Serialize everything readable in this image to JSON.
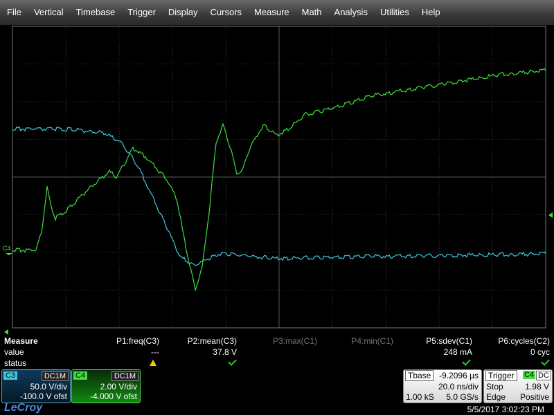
{
  "menu": [
    "File",
    "Vertical",
    "Timebase",
    "Trigger",
    "Display",
    "Cursors",
    "Measure",
    "Math",
    "Analysis",
    "Utilities",
    "Help"
  ],
  "colors": {
    "c3": "#40c8e0",
    "c4": "#40e040",
    "grid": "#5a5a5a"
  },
  "markers": {
    "c4_label": "C4"
  },
  "measure": {
    "title": "Measure",
    "row_labels": [
      "value",
      "status"
    ],
    "params": [
      {
        "label": "P1:freq(C3)",
        "value": "---",
        "status": "warn-icon",
        "dim": false
      },
      {
        "label": "P2:mean(C3)",
        "value": "37.8 V",
        "status": "check-icon",
        "dim": false
      },
      {
        "label": "P3:max(C1)",
        "value": "",
        "status": "",
        "dim": true
      },
      {
        "label": "P4:min(C1)",
        "value": "",
        "status": "",
        "dim": true
      },
      {
        "label": "P5:sdev(C1)",
        "value": "248 mA",
        "status": "check-icon",
        "dim": false
      },
      {
        "label": "P6:cycles(C2)",
        "value": "0 cyc",
        "status": "check-icon",
        "dim": false
      }
    ]
  },
  "channels": {
    "c3": {
      "tag": "C3",
      "coupling": "DC1M",
      "vdiv": "50.0 V/div",
      "offset": "-100.0 V ofst"
    },
    "c4": {
      "tag": "C4",
      "coupling": "DC1M",
      "vdiv": "2.00 V/div",
      "offset": "-4.000 V ofst"
    }
  },
  "timebase": {
    "label": "Tbase",
    "delay": "-9.2096 µs",
    "tdiv": "20.0 ns/div",
    "samples": "1.00 kS",
    "rate": "5.0 GS/s"
  },
  "trigger": {
    "label": "Trigger",
    "source": "C4",
    "coupling": "DC",
    "mode": "Stop",
    "level": "1.98 V",
    "type": "Edge",
    "slope": "Positive"
  },
  "brand": "LeCroy",
  "timestamp": "5/5/2017 3:02:23 PM"
}
